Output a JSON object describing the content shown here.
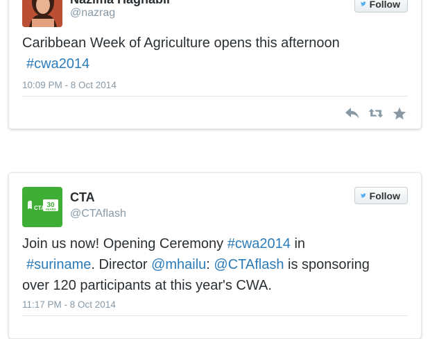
{
  "tweets": [
    {
      "name": "Nazima Haghabli",
      "handle": "@nazrag",
      "follow_label": "Follow",
      "text_plain": "Caribbean Week of Agriculture opens this afternoon",
      "hashtag": "#cwa2014",
      "timestamp": "10:09 PM - 8 Oct 2014",
      "actions": [
        "reply-icon",
        "retweet-icon",
        "favorite-icon"
      ]
    },
    {
      "name": "CTA",
      "handle": "@CTAflash",
      "follow_label": "Follow",
      "avatar_badge": "30",
      "avatar_badge_sub": "YEARS",
      "avatar_brand": "CTA",
      "text_parts": {
        "p1": "Join us now! Opening Ceremony ",
        "l1": "#cwa2014",
        "p2": " in ",
        "l2": "#suriname",
        "p3": ". Director ",
        "l3": "@mhailu",
        "p4": ": ",
        "l4": "@CTAflash",
        "p5": " is sponsoring over 120 participants at this year's CWA."
      },
      "timestamp": "11:17 PM - 8 Oct 2014"
    }
  ],
  "colors": {
    "link": "#2b7bb9",
    "muted": "#8899a6",
    "cta_green": "#3fae35",
    "twitter_blue": "#55acee"
  }
}
